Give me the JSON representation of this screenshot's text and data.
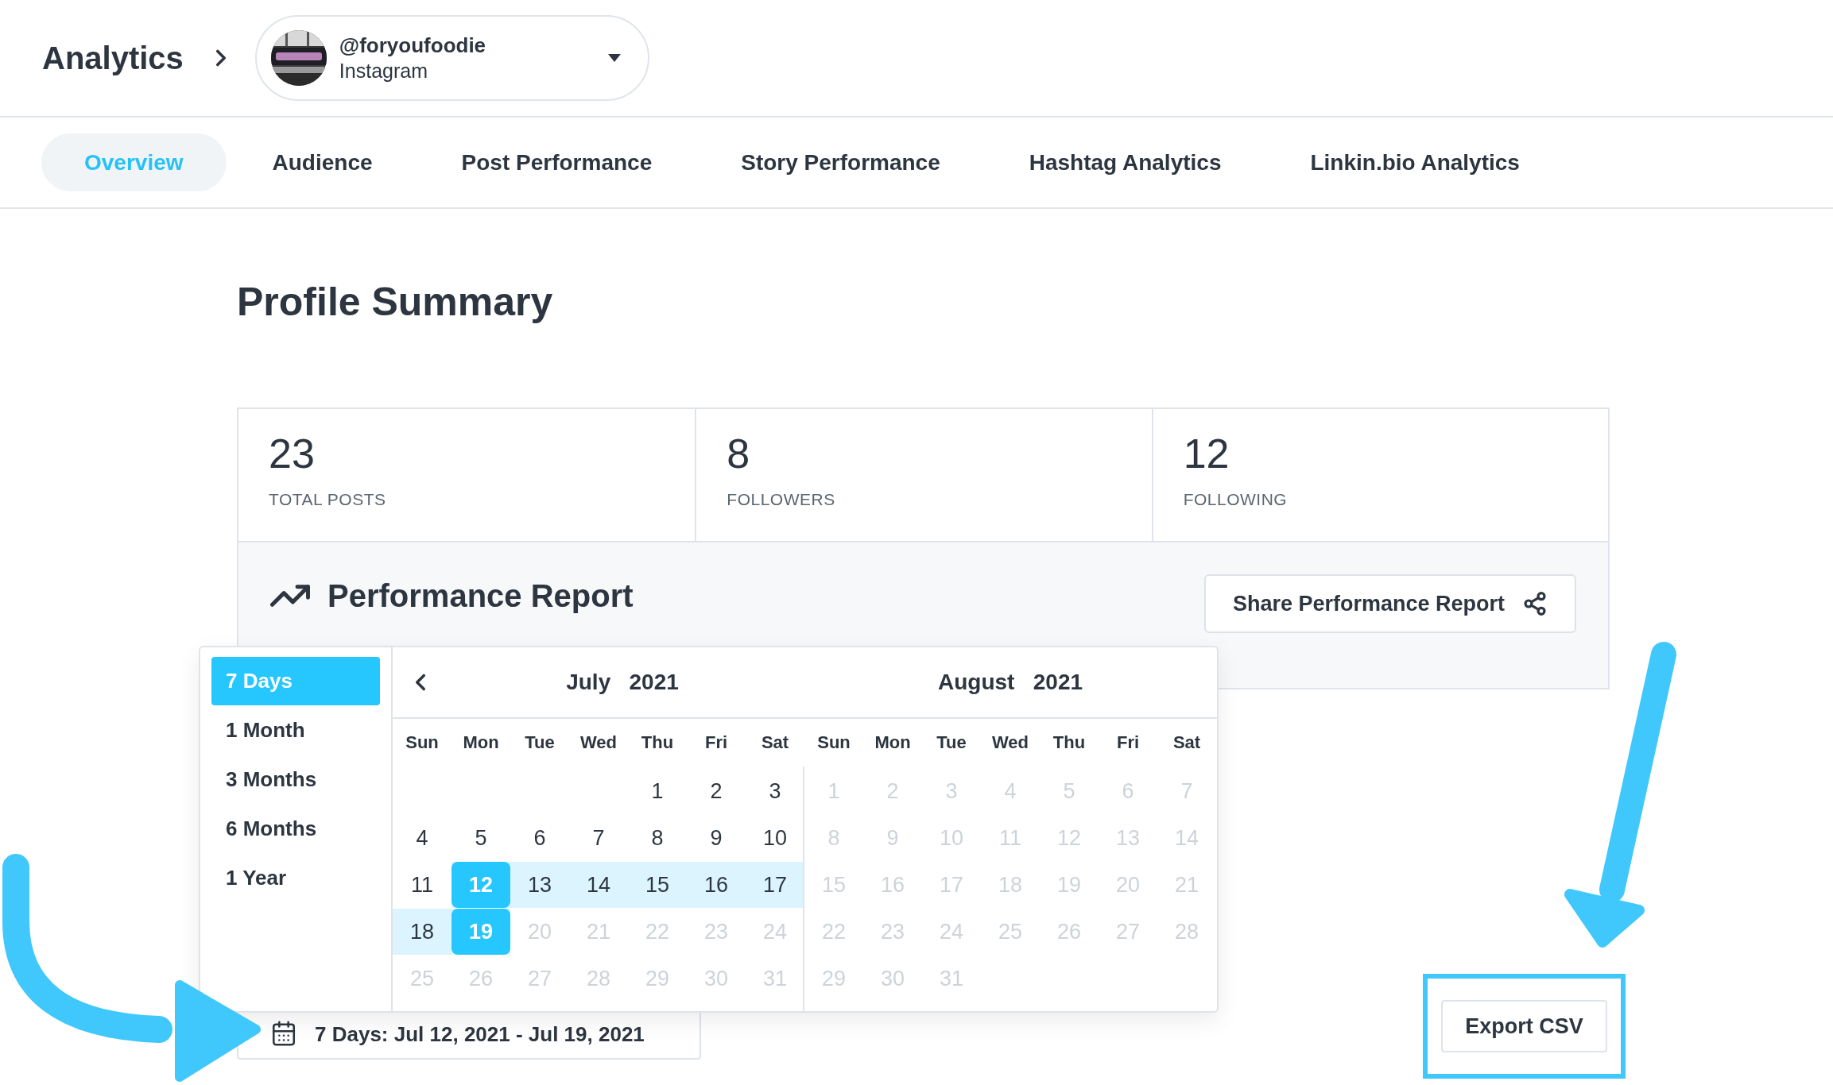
{
  "header": {
    "title": "Analytics",
    "account": {
      "handle": "@foryoufoodie",
      "network": "Instagram"
    }
  },
  "tabs": [
    {
      "label": "Overview",
      "selected": true
    },
    {
      "label": "Audience",
      "selected": false
    },
    {
      "label": "Post Performance",
      "selected": false
    },
    {
      "label": "Story Performance",
      "selected": false
    },
    {
      "label": "Hashtag Analytics",
      "selected": false
    },
    {
      "label": "Linkin.bio Analytics",
      "selected": false
    }
  ],
  "summary": {
    "title": "Profile Summary",
    "stats": [
      {
        "value": "23",
        "label": "TOTAL POSTS"
      },
      {
        "value": "8",
        "label": "FOLLOWERS"
      },
      {
        "value": "12",
        "label": "FOLLOWING"
      }
    ]
  },
  "performance_report": {
    "title": "Performance Report",
    "share_button": "Share Performance Report"
  },
  "date_range": {
    "label": "7 Days: Jul 12, 2021 - Jul 19, 2021"
  },
  "date_picker": {
    "presets": [
      {
        "label": "7 Days",
        "selected": true
      },
      {
        "label": "1 Month",
        "selected": false
      },
      {
        "label": "3 Months",
        "selected": false
      },
      {
        "label": "6 Months",
        "selected": false
      },
      {
        "label": "1 Year",
        "selected": false
      }
    ],
    "months": [
      {
        "month": "July",
        "year": "2021",
        "weekdays": [
          "Sun",
          "Mon",
          "Tue",
          "Wed",
          "Thu",
          "Fri",
          "Sat"
        ],
        "weeks": [
          [
            {
              "kind": "blank"
            },
            {
              "kind": "blank"
            },
            {
              "kind": "blank"
            },
            {
              "kind": "blank"
            },
            {
              "kind": "day",
              "day": "1",
              "disabled": false,
              "in_range": false,
              "selected": false
            },
            {
              "kind": "day",
              "day": "2",
              "disabled": false,
              "in_range": false,
              "selected": false
            },
            {
              "kind": "day",
              "day": "3",
              "disabled": false,
              "in_range": false,
              "selected": false
            }
          ],
          [
            {
              "kind": "day",
              "day": "4",
              "disabled": false,
              "in_range": false,
              "selected": false
            },
            {
              "kind": "day",
              "day": "5",
              "disabled": false,
              "in_range": false,
              "selected": false
            },
            {
              "kind": "day",
              "day": "6",
              "disabled": false,
              "in_range": false,
              "selected": false
            },
            {
              "kind": "day",
              "day": "7",
              "disabled": false,
              "in_range": false,
              "selected": false
            },
            {
              "kind": "day",
              "day": "8",
              "disabled": false,
              "in_range": false,
              "selected": false
            },
            {
              "kind": "day",
              "day": "9",
              "disabled": false,
              "in_range": false,
              "selected": false
            },
            {
              "kind": "day",
              "day": "10",
              "disabled": false,
              "in_range": false,
              "selected": false
            }
          ],
          [
            {
              "kind": "day",
              "day": "11",
              "disabled": false,
              "in_range": false,
              "selected": false
            },
            {
              "kind": "day",
              "day": "12",
              "disabled": false,
              "in_range": true,
              "selected": true
            },
            {
              "kind": "day",
              "day": "13",
              "disabled": false,
              "in_range": true,
              "selected": false
            },
            {
              "kind": "day",
              "day": "14",
              "disabled": false,
              "in_range": true,
              "selected": false
            },
            {
              "kind": "day",
              "day": "15",
              "disabled": false,
              "in_range": true,
              "selected": false
            },
            {
              "kind": "day",
              "day": "16",
              "disabled": false,
              "in_range": true,
              "selected": false
            },
            {
              "kind": "day",
              "day": "17",
              "disabled": false,
              "in_range": true,
              "selected": false
            }
          ],
          [
            {
              "kind": "day",
              "day": "18",
              "disabled": false,
              "in_range": true,
              "selected": false
            },
            {
              "kind": "day",
              "day": "19",
              "disabled": false,
              "in_range": true,
              "selected": true
            },
            {
              "kind": "day",
              "day": "20",
              "disabled": true,
              "in_range": false,
              "selected": false
            },
            {
              "kind": "day",
              "day": "21",
              "disabled": true,
              "in_range": false,
              "selected": false
            },
            {
              "kind": "day",
              "day": "22",
              "disabled": true,
              "in_range": false,
              "selected": false
            },
            {
              "kind": "day",
              "day": "23",
              "disabled": true,
              "in_range": false,
              "selected": false
            },
            {
              "kind": "day",
              "day": "24",
              "disabled": true,
              "in_range": false,
              "selected": false
            }
          ],
          [
            {
              "kind": "day",
              "day": "25",
              "disabled": true,
              "in_range": false,
              "selected": false
            },
            {
              "kind": "day",
              "day": "26",
              "disabled": true,
              "in_range": false,
              "selected": false
            },
            {
              "kind": "day",
              "day": "27",
              "disabled": true,
              "in_range": false,
              "selected": false
            },
            {
              "kind": "day",
              "day": "28",
              "disabled": true,
              "in_range": false,
              "selected": false
            },
            {
              "kind": "day",
              "day": "29",
              "disabled": true,
              "in_range": false,
              "selected": false
            },
            {
              "kind": "day",
              "day": "30",
              "disabled": true,
              "in_range": false,
              "selected": false
            },
            {
              "kind": "day",
              "day": "31",
              "disabled": true,
              "in_range": false,
              "selected": false
            }
          ]
        ]
      },
      {
        "month": "August",
        "year": "2021",
        "weekdays": [
          "Sun",
          "Mon",
          "Tue",
          "Wed",
          "Thu",
          "Fri",
          "Sat"
        ],
        "weeks": [
          [
            {
              "kind": "day",
              "day": "1",
              "disabled": true,
              "in_range": false,
              "selected": false
            },
            {
              "kind": "day",
              "day": "2",
              "disabled": true,
              "in_range": false,
              "selected": false
            },
            {
              "kind": "day",
              "day": "3",
              "disabled": true,
              "in_range": false,
              "selected": false
            },
            {
              "kind": "day",
              "day": "4",
              "disabled": true,
              "in_range": false,
              "selected": false
            },
            {
              "kind": "day",
              "day": "5",
              "disabled": true,
              "in_range": false,
              "selected": false
            },
            {
              "kind": "day",
              "day": "6",
              "disabled": true,
              "in_range": false,
              "selected": false
            },
            {
              "kind": "day",
              "day": "7",
              "disabled": true,
              "in_range": false,
              "selected": false
            }
          ],
          [
            {
              "kind": "day",
              "day": "8",
              "disabled": true,
              "in_range": false,
              "selected": false
            },
            {
              "kind": "day",
              "day": "9",
              "disabled": true,
              "in_range": false,
              "selected": false
            },
            {
              "kind": "day",
              "day": "10",
              "disabled": true,
              "in_range": false,
              "selected": false
            },
            {
              "kind": "day",
              "day": "11",
              "disabled": true,
              "in_range": false,
              "selected": false
            },
            {
              "kind": "day",
              "day": "12",
              "disabled": true,
              "in_range": false,
              "selected": false
            },
            {
              "kind": "day",
              "day": "13",
              "disabled": true,
              "in_range": false,
              "selected": false
            },
            {
              "kind": "day",
              "day": "14",
              "disabled": true,
              "in_range": false,
              "selected": false
            }
          ],
          [
            {
              "kind": "day",
              "day": "15",
              "disabled": true,
              "in_range": false,
              "selected": false
            },
            {
              "kind": "day",
              "day": "16",
              "disabled": true,
              "in_range": false,
              "selected": false
            },
            {
              "kind": "day",
              "day": "17",
              "disabled": true,
              "in_range": false,
              "selected": false
            },
            {
              "kind": "day",
              "day": "18",
              "disabled": true,
              "in_range": false,
              "selected": false
            },
            {
              "kind": "day",
              "day": "19",
              "disabled": true,
              "in_range": false,
              "selected": false
            },
            {
              "kind": "day",
              "day": "20",
              "disabled": true,
              "in_range": false,
              "selected": false
            },
            {
              "kind": "day",
              "day": "21",
              "disabled": true,
              "in_range": false,
              "selected": false
            }
          ],
          [
            {
              "kind": "day",
              "day": "22",
              "disabled": true,
              "in_range": false,
              "selected": false
            },
            {
              "kind": "day",
              "day": "23",
              "disabled": true,
              "in_range": false,
              "selected": false
            },
            {
              "kind": "day",
              "day": "24",
              "disabled": true,
              "in_range": false,
              "selected": false
            },
            {
              "kind": "day",
              "day": "25",
              "disabled": true,
              "in_range": false,
              "selected": false
            },
            {
              "kind": "day",
              "day": "26",
              "disabled": true,
              "in_range": false,
              "selected": false
            },
            {
              "kind": "day",
              "day": "27",
              "disabled": true,
              "in_range": false,
              "selected": false
            },
            {
              "kind": "day",
              "day": "28",
              "disabled": true,
              "in_range": false,
              "selected": false
            }
          ],
          [
            {
              "kind": "day",
              "day": "29",
              "disabled": true,
              "in_range": false,
              "selected": false
            },
            {
              "kind": "day",
              "day": "30",
              "disabled": true,
              "in_range": false,
              "selected": false
            },
            {
              "kind": "day",
              "day": "31",
              "disabled": true,
              "in_range": false,
              "selected": false
            },
            {
              "kind": "blank"
            },
            {
              "kind": "blank"
            },
            {
              "kind": "blank"
            },
            {
              "kind": "blank"
            }
          ]
        ]
      }
    ]
  },
  "export_button": "Export CSV"
}
